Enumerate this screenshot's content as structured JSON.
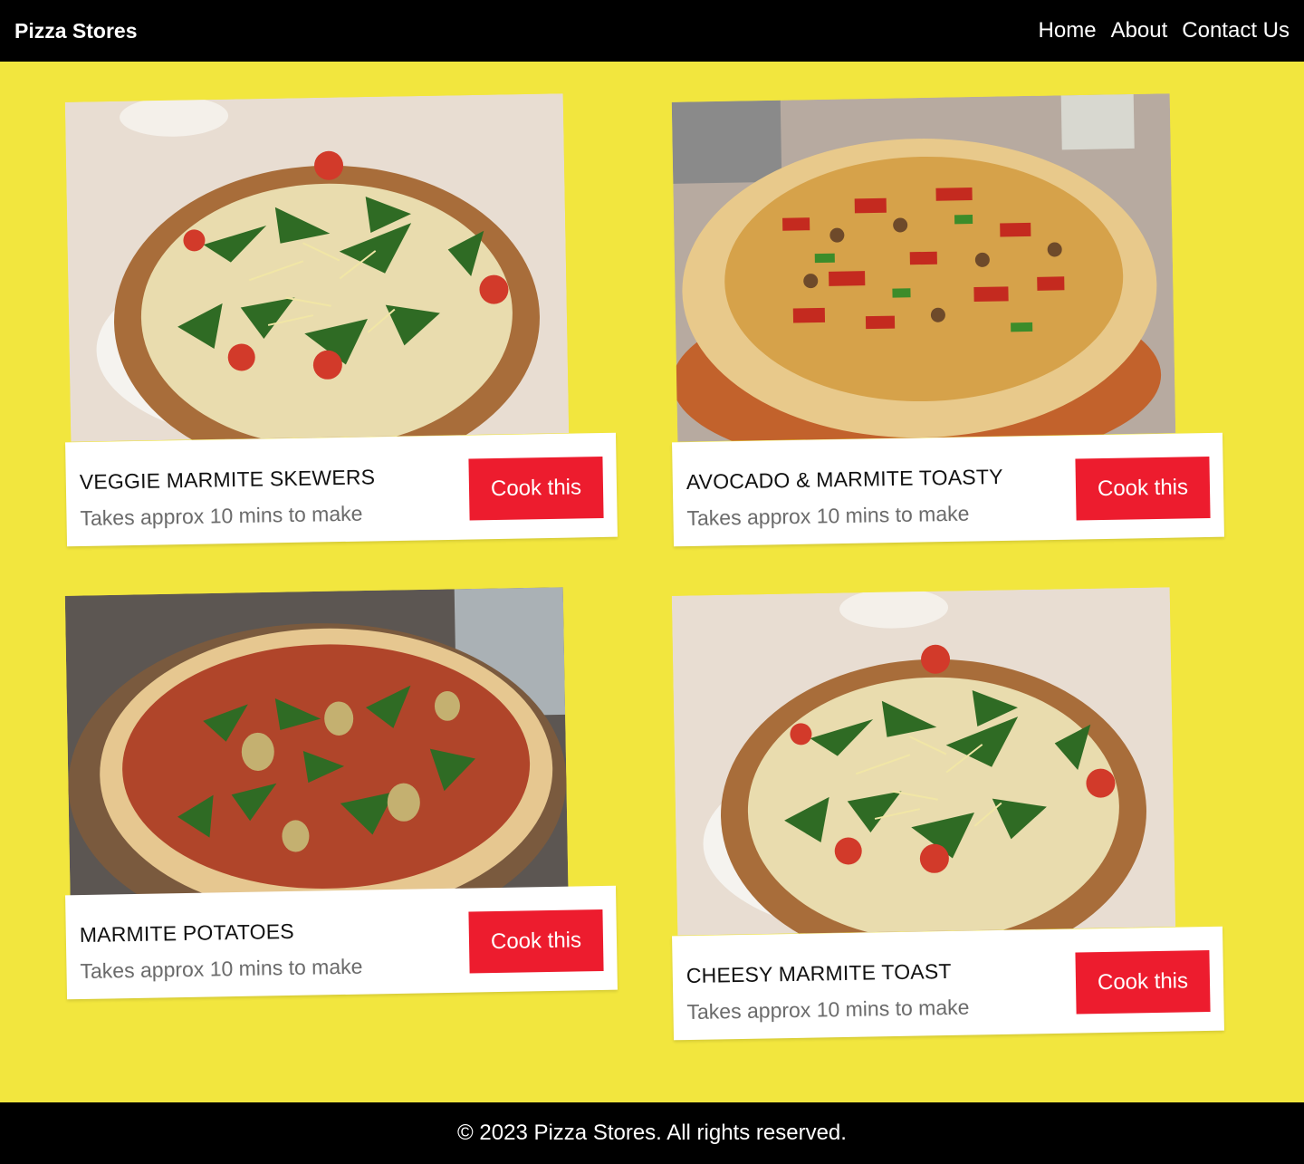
{
  "header": {
    "brand": "Pizza Stores",
    "nav": [
      {
        "label": "Home"
      },
      {
        "label": "About"
      },
      {
        "label": "Contact Us"
      }
    ]
  },
  "recipes": [
    {
      "title": "VEGGIE MARMITE SKEWERS",
      "subtitle": "Takes approx 10 mins to make",
      "button": "Cook this",
      "image": "pizza-photo"
    },
    {
      "title": "AVOCADO & MARMITE TOASTY",
      "subtitle": "Takes approx 10 mins to make",
      "button": "Cook this",
      "image": "pizza-photo"
    },
    {
      "title": "MARMITE POTATOES",
      "subtitle": "Takes approx 10 mins to make",
      "button": "Cook this",
      "image": "pizza-photo"
    },
    {
      "title": "CHEESY MARMITE TOAST",
      "subtitle": "Takes approx 10 mins to make",
      "button": "Cook this",
      "image": "pizza-photo"
    }
  ],
  "footer": {
    "text": "© 2023 Pizza Stores. All rights reserved."
  },
  "colors": {
    "background": "#f2e63e",
    "header_bg": "#000000",
    "button_bg": "#ed1c2e",
    "card_bg": "#ffffff"
  }
}
